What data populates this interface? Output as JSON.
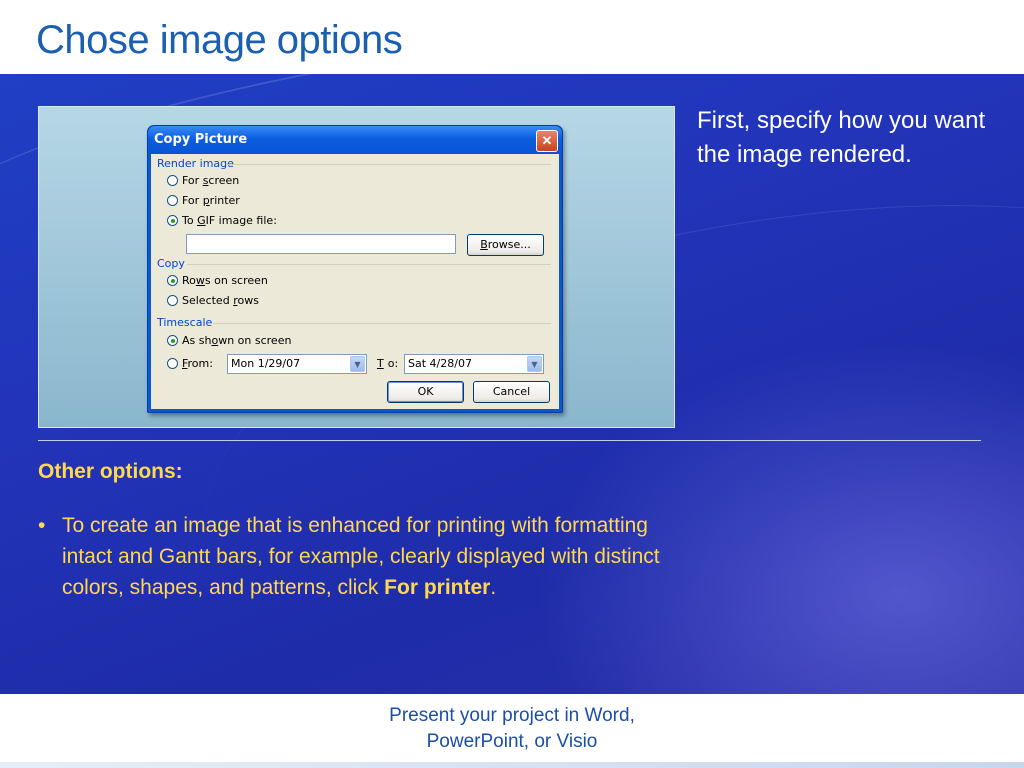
{
  "slide": {
    "title": "Chose image options",
    "side_text": "First, specify how you want the image rendered.",
    "subheading": "Other options:",
    "bullet_before": "To create an image that is enhanced for printing with formatting intact and Gantt bars, for example, clearly displayed with distinct colors, shapes, and patterns, click ",
    "bullet_bold": "For printer",
    "bullet_after": ".",
    "footer_line1": "Present your project in Word,",
    "footer_line2": "PowerPoint, or Visio"
  },
  "dialog": {
    "title": "Copy Picture",
    "close_glyph": "✕",
    "render_group": "Render image",
    "opt_for_screen_pre": "For ",
    "opt_for_screen_u": "s",
    "opt_for_screen_post": "creen",
    "opt_for_printer_pre": "For ",
    "opt_for_printer_u": "p",
    "opt_for_printer_post": "rinter",
    "opt_to_gif_pre": "To ",
    "opt_to_gif_u": "G",
    "opt_to_gif_post": "IF image file:",
    "gif_path_value": "",
    "browse_pre": "",
    "browse_u": "B",
    "browse_post": "rowse...",
    "copy_group": "Copy",
    "opt_rows_pre": "Ro",
    "opt_rows_u": "w",
    "opt_rows_post": "s on screen",
    "opt_selected_pre": "Selected ",
    "opt_selected_u": "r",
    "opt_selected_post": "ows",
    "timescale_group": "Timescale",
    "opt_asshown_pre": "As sh",
    "opt_asshown_u": "o",
    "opt_asshown_post": "wn on screen",
    "opt_from_pre": "",
    "opt_from_u": "F",
    "opt_from_post": "rom:",
    "from_value": "Mon 1/29/07",
    "to_label_u": "T",
    "to_label_post": "o:",
    "to_value": "Sat 4/28/07",
    "ok_label": "OK",
    "cancel_label": "Cancel",
    "dropdown_glyph": "▼"
  },
  "colors": {
    "title": "#1a5fb0",
    "background_blue": "#1f3fc4",
    "highlight_text": "#ffd84d",
    "footer_text": "#1a4fa8"
  }
}
